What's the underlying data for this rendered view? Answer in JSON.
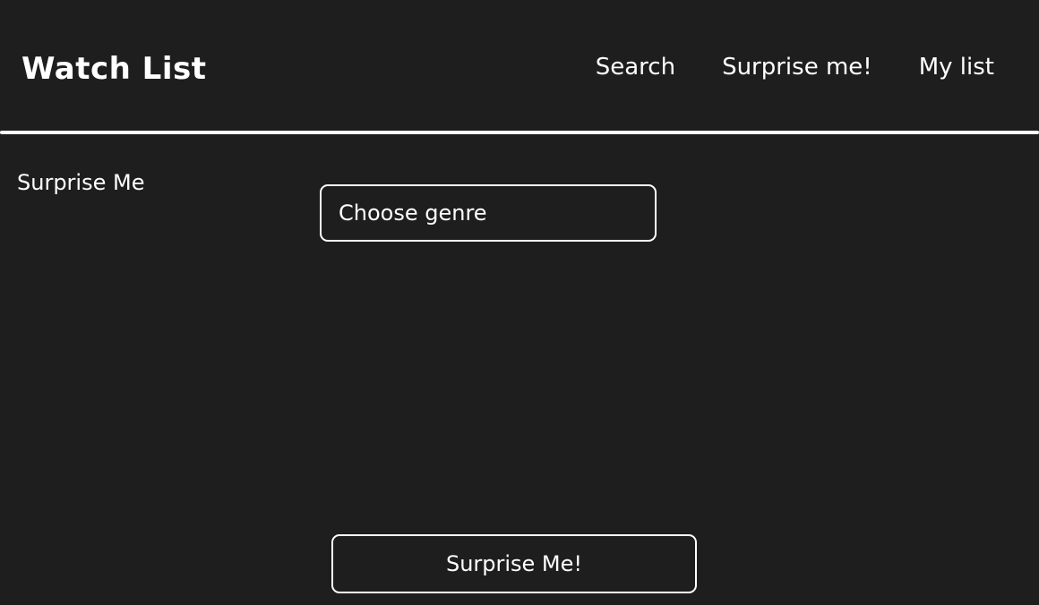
{
  "header": {
    "title": "Watch List",
    "nav": {
      "search": "Search",
      "surprise": "Surprise me!",
      "my_list": "My list"
    }
  },
  "main": {
    "page_title": "Surprise Me",
    "genre_select": {
      "placeholder": "Choose genre"
    },
    "action_button": "Surprise Me!"
  },
  "colors": {
    "background": "#1e1e1e",
    "foreground": "#ffffff"
  }
}
